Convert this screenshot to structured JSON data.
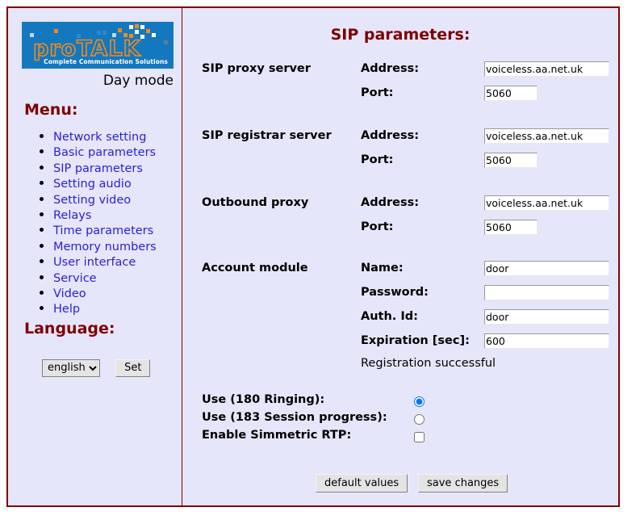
{
  "sidebar": {
    "logo": {
      "brand_pro": "pro",
      "brand_talk": "Talk",
      "trademark": "®",
      "tagline": "Complete Communication Solutions",
      "background_color": "#1478be",
      "text_color": "#f08a1e"
    },
    "mode_label": "Day mode",
    "menu_heading": "Menu:",
    "menu_items": [
      {
        "label": "Network setting"
      },
      {
        "label": "Basic parameters"
      },
      {
        "label": "SIP parameters"
      },
      {
        "label": "Setting audio"
      },
      {
        "label": "Setting video"
      },
      {
        "label": "Relays"
      },
      {
        "label": "Time parameters"
      },
      {
        "label": "Memory numbers"
      },
      {
        "label": "User interface"
      },
      {
        "label": "Service"
      },
      {
        "label": "Video"
      },
      {
        "label": "Help"
      }
    ],
    "language_heading": "Language:",
    "language_selected": "english",
    "language_options": [
      "english"
    ],
    "set_button": "Set"
  },
  "main": {
    "title": "SIP parameters:",
    "groups": [
      {
        "name": "SIP proxy server",
        "fields": [
          {
            "label": "Address:",
            "value": "voiceless.aa.net.uk"
          },
          {
            "label": "Port:",
            "value": "5060"
          }
        ]
      },
      {
        "name": "SIP registrar server",
        "fields": [
          {
            "label": "Address:",
            "value": "voiceless.aa.net.uk"
          },
          {
            "label": "Port:",
            "value": "5060"
          }
        ]
      },
      {
        "name": "Outbound proxy",
        "fields": [
          {
            "label": "Address:",
            "value": "voiceless.aa.net.uk"
          },
          {
            "label": "Port:",
            "value": "5060"
          }
        ]
      },
      {
        "name": "Account module",
        "fields": [
          {
            "label": "Name:",
            "value": "door"
          },
          {
            "label": "Password:",
            "value": ""
          },
          {
            "label": "Auth. Id:",
            "value": "door"
          },
          {
            "label": "Expiration [sec]:",
            "value": "600"
          }
        ]
      }
    ],
    "registration_status": "Registration successful",
    "options": [
      {
        "label": "Use (180 Ringing):",
        "type": "radio",
        "checked": true
      },
      {
        "label": "Use (183 Session progress):",
        "type": "radio",
        "checked": false
      },
      {
        "label": "Enable Simmetric RTP:",
        "type": "checkbox",
        "checked": false
      }
    ],
    "default_button": "default values",
    "save_button": "save changes"
  },
  "theme": {
    "page_background": "#e6e6fa",
    "border_color": "#7d0000",
    "heading_color": "#7d0000",
    "link_color": "#2b21d4"
  }
}
